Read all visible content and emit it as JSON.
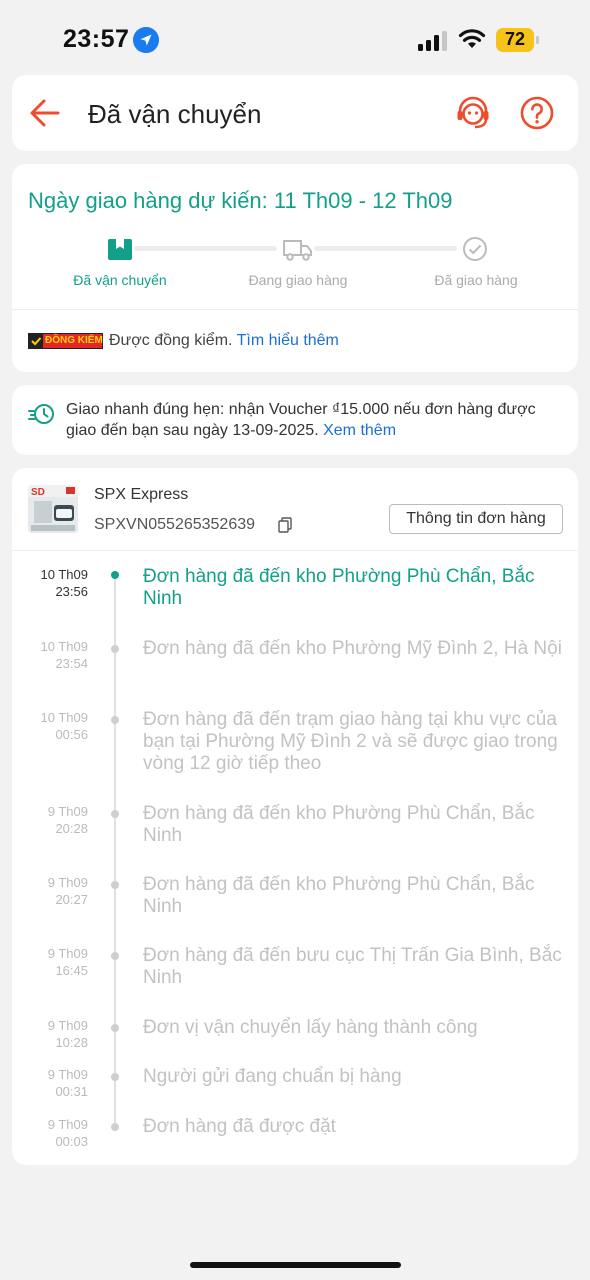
{
  "status_bar": {
    "time": "23:57",
    "battery": "72"
  },
  "header": {
    "title": "Đã vận chuyển"
  },
  "delivery": {
    "eta": "Ngày giao hàng dự kiến: 11 Th09 - 12 Th09",
    "steps": [
      {
        "label": "Đã vận chuyển",
        "state": "active"
      },
      {
        "label": "Đang giao hàng",
        "state": "pending"
      },
      {
        "label": "Đã giao hàng",
        "state": "pending"
      }
    ],
    "inspection": {
      "badge": "ĐỒNG KIỂM",
      "text": "Được đồng kiểm.",
      "link": "Tìm hiểu thêm"
    }
  },
  "voucher": {
    "text": "Giao nhanh đúng hẹn: nhận Voucher ₫15.000 nếu đơn hàng được giao đến bạn sau ngày 13-09-2025.",
    "link": "Xem thêm"
  },
  "shipment": {
    "carrier": "SPX Express",
    "tracking_number": "SPXVN055265352639",
    "order_info_button": "Thông tin đơn hàng",
    "events": [
      {
        "date": "10 Th09",
        "time": "23:56",
        "text": "Đơn hàng đã đến kho Phường Phù Chẩn, Bắc Ninh",
        "current": true
      },
      {
        "date": "10 Th09",
        "time": "23:54",
        "text": "Đơn hàng đã đến kho Phường Mỹ Đình 2, Hà Nội",
        "current": false
      },
      {
        "date": "10 Th09",
        "time": "00:56",
        "text": "Đơn hàng đã đến trạm giao hàng tại khu vực của bạn tại Phường Mỹ Đình 2 và sẽ được giao trong vòng 12 giờ tiếp theo",
        "current": false
      },
      {
        "date": "9 Th09",
        "time": "20:28",
        "text": "Đơn hàng đã đến kho Phường Phù Chẩn, Bắc Ninh",
        "current": false
      },
      {
        "date": "9 Th09",
        "time": "20:27",
        "text": "Đơn hàng đã đến kho Phường Phù Chẩn, Bắc Ninh",
        "current": false
      },
      {
        "date": "9 Th09",
        "time": "16:45",
        "text": "Đơn hàng đã đến bưu cục Thị Trấn Gia Bình, Bắc Ninh",
        "current": false
      },
      {
        "date": "9 Th09",
        "time": "10:28",
        "text": "Đơn vị vận chuyển lấy hàng thành công",
        "current": false
      },
      {
        "date": "9 Th09",
        "time": "00:31",
        "text": "Người gửi đang chuẩn bị hàng",
        "current": false
      },
      {
        "date": "9 Th09",
        "time": "00:03",
        "text": "Đơn hàng đã được đặt",
        "current": false
      }
    ]
  },
  "colors": {
    "accent_green": "#12a08a",
    "brand_orange": "#ee4d2d",
    "link_blue": "#1c6fd1"
  }
}
